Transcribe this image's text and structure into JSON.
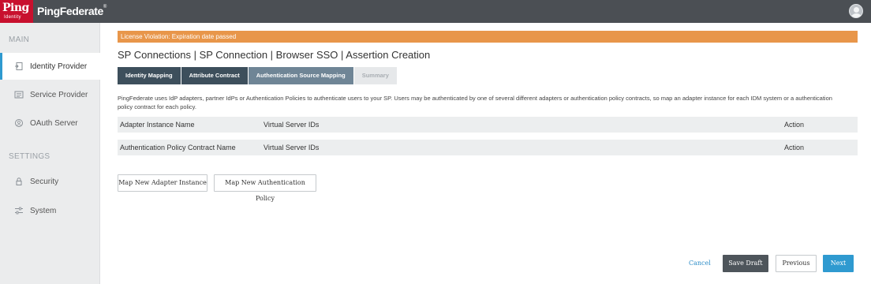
{
  "header": {
    "logo_text": "Ping",
    "logo_sub": "Identity",
    "product_name": "PingFederate",
    "trademark": "®",
    "user_icon": "user-circle-icon"
  },
  "sidebar": {
    "sections": [
      {
        "label": "MAIN",
        "items": [
          {
            "label": "Identity Provider",
            "icon": "identity-provider-icon",
            "active": true
          },
          {
            "label": "Service Provider",
            "icon": "service-provider-icon",
            "active": false
          },
          {
            "label": "OAuth Server",
            "icon": "oauth-server-icon",
            "active": false
          }
        ]
      },
      {
        "label": "SETTINGS",
        "items": [
          {
            "label": "Security",
            "icon": "lock-icon",
            "active": false
          },
          {
            "label": "System",
            "icon": "sliders-icon",
            "active": false
          }
        ]
      }
    ]
  },
  "main": {
    "license_warning": "License Violation: Expiration date passed",
    "title": "SP Connections | SP Connection | Browser SSO | Assertion Creation",
    "tabs": [
      {
        "label": "Identity Mapping",
        "state": "done"
      },
      {
        "label": "Attribute Contract",
        "state": "done"
      },
      {
        "label": "Authentication Source Mapping",
        "state": "current"
      },
      {
        "label": "Summary",
        "state": "future"
      }
    ],
    "description": "PingFederate uses IdP adapters, partner IdPs or Authentication Policies to authenticate users to your SP. Users may be authenticated by one of several different adapters or authentication policy contracts, so map an adapter instance for each IDM system or a authentication policy contract for each policy.",
    "adapter_table": {
      "columns": [
        "Adapter Instance Name",
        "Virtual Server IDs",
        "Action"
      ]
    },
    "policy_table": {
      "columns": [
        "Authentication Policy Contract Name",
        "Virtual Server IDs",
        "Action"
      ]
    },
    "buttons": {
      "map_adapter": "Map New Adapter Instance",
      "map_policy": "Map New Authentication Policy"
    }
  },
  "footer": {
    "cancel": "Cancel",
    "save_draft": "Save Draft",
    "previous": "Previous",
    "next": "Next"
  },
  "colors": {
    "topbar": "#4b4f54",
    "brand_red": "#c8102e",
    "license_orange": "#e8964a",
    "accent_blue": "#2f9ad0",
    "tab_done": "#3d4f5c",
    "tab_current": "#6f8596"
  }
}
